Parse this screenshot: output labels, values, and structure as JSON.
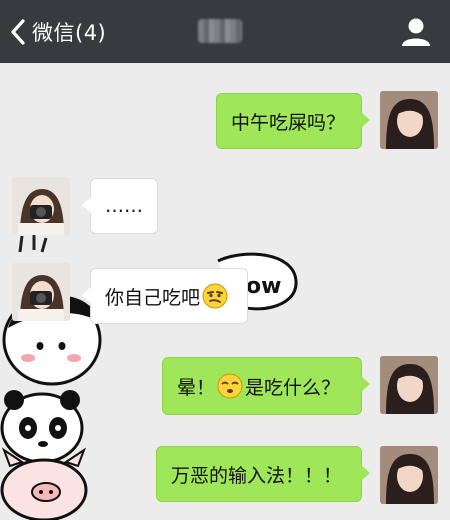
{
  "header": {
    "back_label": "微信(4)"
  },
  "messages": [
    {
      "text": "中午吃屎吗？"
    },
    {
      "text": "……"
    },
    {
      "text_before": "你自己吃吧",
      "emoji": "smirk-emoji"
    },
    {
      "text_before": "晕！",
      "emoji": "dizzy-emoji",
      "text_after": "是吃什么？"
    },
    {
      "text": "万恶的输入法！！！"
    }
  ],
  "sticker": {
    "text": "ow"
  },
  "icons": {
    "back": "chevron-left-icon",
    "profile": "person-icon"
  },
  "colors": {
    "topbar": "#393a3f",
    "bubble_green": "#9fe658",
    "chat_bg": "#ececec"
  }
}
